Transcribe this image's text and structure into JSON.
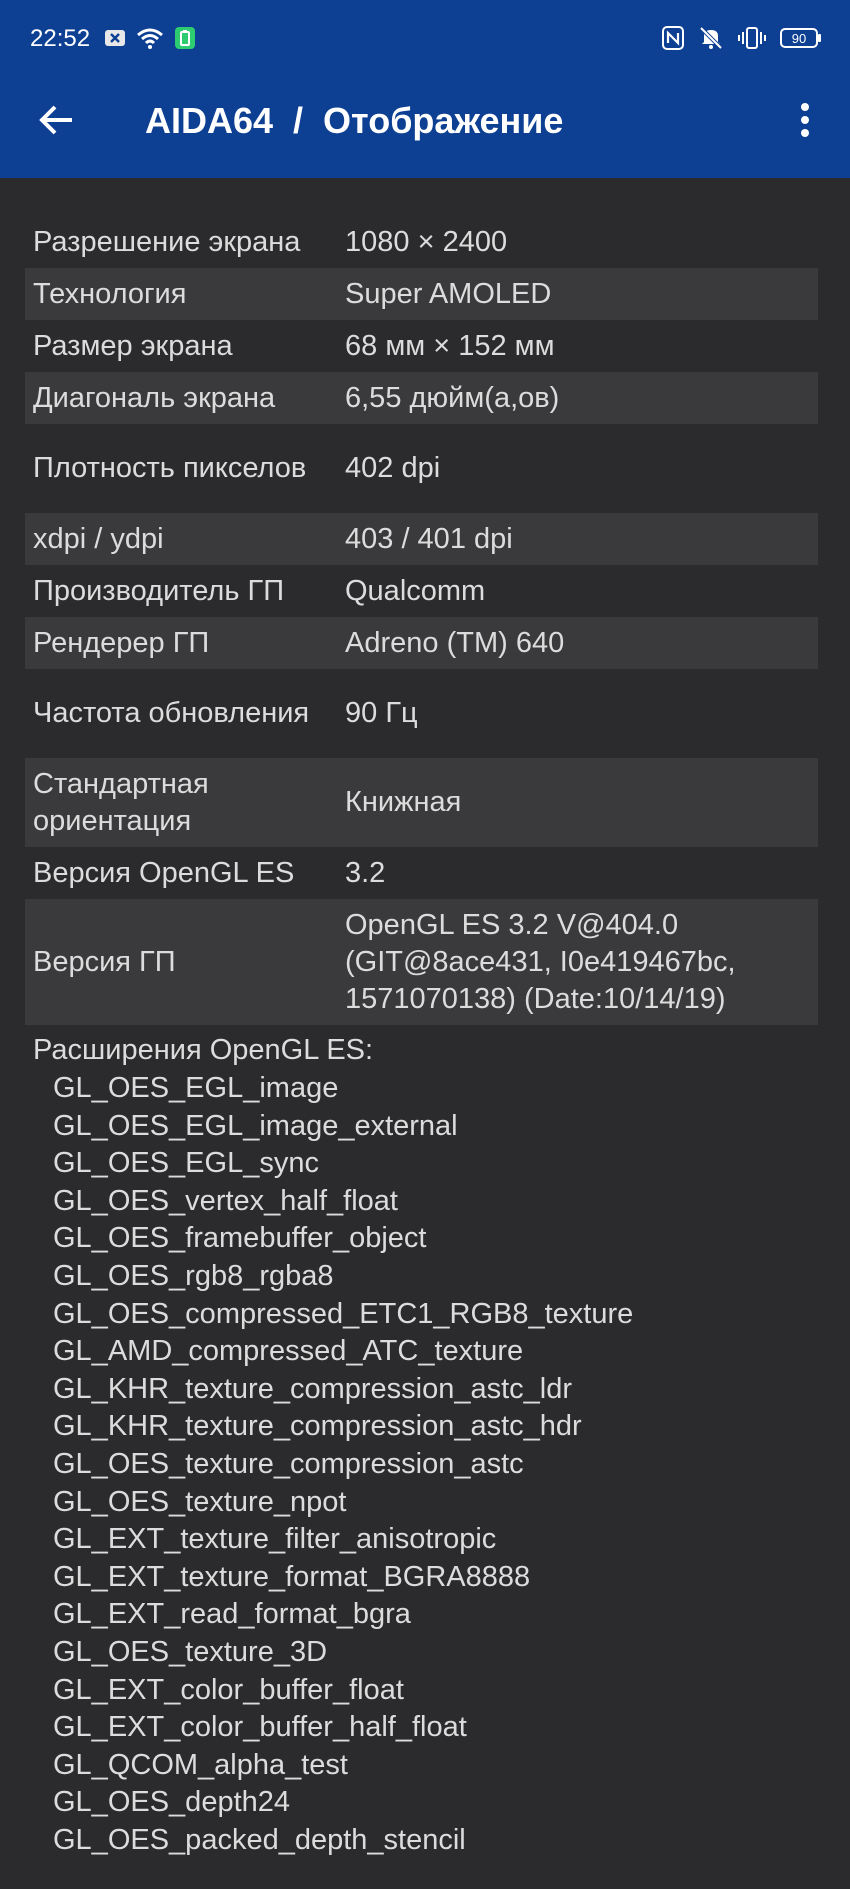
{
  "status_bar": {
    "time": "22:52",
    "battery": "90",
    "icons": [
      "notification-x-icon",
      "wifi-icon",
      "battery-saver-icon",
      "nfc-icon",
      "mute-icon",
      "vibrate-icon",
      "battery-icon"
    ]
  },
  "app_bar": {
    "title": "AIDA64  /  Отображение"
  },
  "colors": {
    "app_bar": "#0d3f93",
    "background": "#2b2b2d",
    "row_alt": "#3a3a3c",
    "text": "#dcdcdc"
  },
  "rows": [
    {
      "key": "Разрешение экрана",
      "value": "1080 × 2400"
    },
    {
      "key": "Технология",
      "value": "Super AMOLED"
    },
    {
      "key": "Размер экрана",
      "value": "68 мм × 152 мм"
    },
    {
      "key": "Диагональ экрана",
      "value": "6,55 дюйм(а,ов)"
    },
    {
      "key": "Плотность пикселов",
      "value": "402 dpi"
    },
    {
      "key": "xdpi / ydpi",
      "value": "403 / 401 dpi"
    },
    {
      "key": "Производитель ГП",
      "value": "Qualcomm"
    },
    {
      "key": "Рендерер ГП",
      "value": "Adreno (TM) 640"
    },
    {
      "key": "Частота обновления",
      "value": "90 Гц"
    },
    {
      "key": "Стандартная ориентация",
      "value": "Книжная"
    },
    {
      "key": "Версия OpenGL ES",
      "value": "3.2"
    },
    {
      "key": "Версия ГП",
      "value": "OpenGL ES 3.2 V@404.0 (GIT@8ace431, I0e419467bc, 1571070138) (Date:10/14/19)"
    }
  ],
  "extensions": {
    "title": "Расширения OpenGL ES:",
    "items": [
      "GL_OES_EGL_image",
      "GL_OES_EGL_image_external",
      "GL_OES_EGL_sync",
      "GL_OES_vertex_half_float",
      "GL_OES_framebuffer_object",
      "GL_OES_rgb8_rgba8",
      "GL_OES_compressed_ETC1_RGB8_texture",
      "GL_AMD_compressed_ATC_texture",
      "GL_KHR_texture_compression_astc_ldr",
      "GL_KHR_texture_compression_astc_hdr",
      "GL_OES_texture_compression_astc",
      "GL_OES_texture_npot",
      "GL_EXT_texture_filter_anisotropic",
      "GL_EXT_texture_format_BGRA8888",
      "GL_EXT_read_format_bgra",
      "GL_OES_texture_3D",
      "GL_EXT_color_buffer_float",
      "GL_EXT_color_buffer_half_float",
      "GL_QCOM_alpha_test",
      "GL_OES_depth24",
      "GL_OES_packed_depth_stencil"
    ]
  }
}
